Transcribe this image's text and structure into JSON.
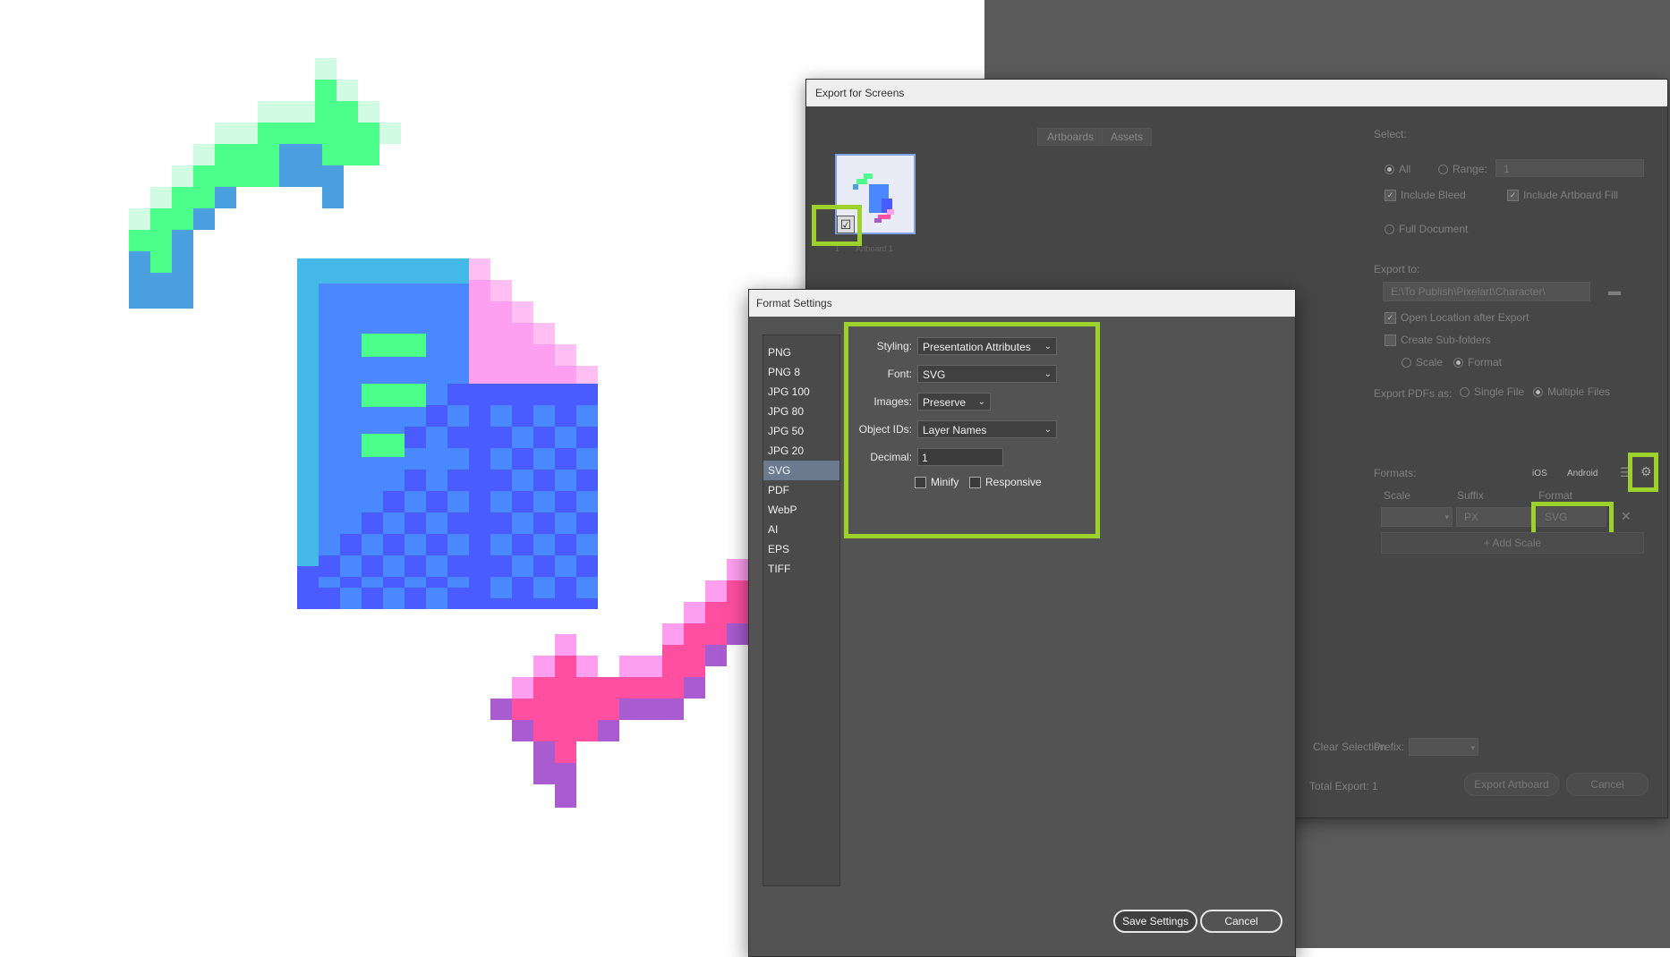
{
  "export_dialog": {
    "title": "Export for Screens",
    "tabs": [
      "Artboards",
      "Assets"
    ],
    "artboard_number": "1",
    "artboard_name": "Artboard 1",
    "select_label": "Select:",
    "radio_all": "All",
    "radio_range": "Range:",
    "range_value": "1",
    "include_bleed": "Include Bleed",
    "include_artboard_fill": "Include Artboard Fill",
    "full_document": "Full Document",
    "export_to_label": "Export to:",
    "export_path": "E:\\To Publish\\Pixelart\\Character\\",
    "open_location": "Open Location after Export",
    "create_subfolders": "Create Sub-folders",
    "scale_option": "Scale",
    "format_option": "Format",
    "export_pdfs_label": "Export PDFs as:",
    "single_file": "Single File",
    "multiple_files": "Multiple Files",
    "formats_label": "Formats:",
    "ios": "iOS",
    "android": "Android",
    "col_scale": "Scale",
    "col_suffix": "Suffix",
    "col_format": "Format",
    "suffix_placeholder": "PX",
    "format_value": "SVG",
    "add_scale": "Add Scale",
    "clear_selection": "Clear Selection",
    "prefix_label": "Prefix:",
    "total_export": "Total Export: 1",
    "export_button": "Export Artboard",
    "cancel_button": "Cancel"
  },
  "format_dialog": {
    "title": "Format Settings",
    "formats": [
      "PNG",
      "PNG 8",
      "JPG 100",
      "JPG 80",
      "JPG 50",
      "JPG 20",
      "SVG",
      "PDF",
      "WebP",
      "AI",
      "EPS",
      "TIFF"
    ],
    "selected_format": "SVG",
    "styling_label": "Styling:",
    "styling_value": "Presentation Attributes",
    "font_label": "Font:",
    "font_value": "SVG",
    "images_label": "Images:",
    "images_value": "Preserve",
    "object_ids_label": "Object IDs:",
    "object_ids_value": "Layer Names",
    "decimal_label": "Decimal:",
    "decimal_value": "1",
    "minify_label": "Minify",
    "responsive_label": "Responsive",
    "save_button": "Save Settings",
    "cancel_button": "Cancel"
  },
  "colors": {
    "highlight": "#9cd22b",
    "green": "#4cff8b",
    "blue_light": "#44b8e6",
    "blue": "#4a88ff",
    "indigo": "#4a5cff",
    "pink": "#ff4fa0",
    "purple": "#a85ccf"
  }
}
